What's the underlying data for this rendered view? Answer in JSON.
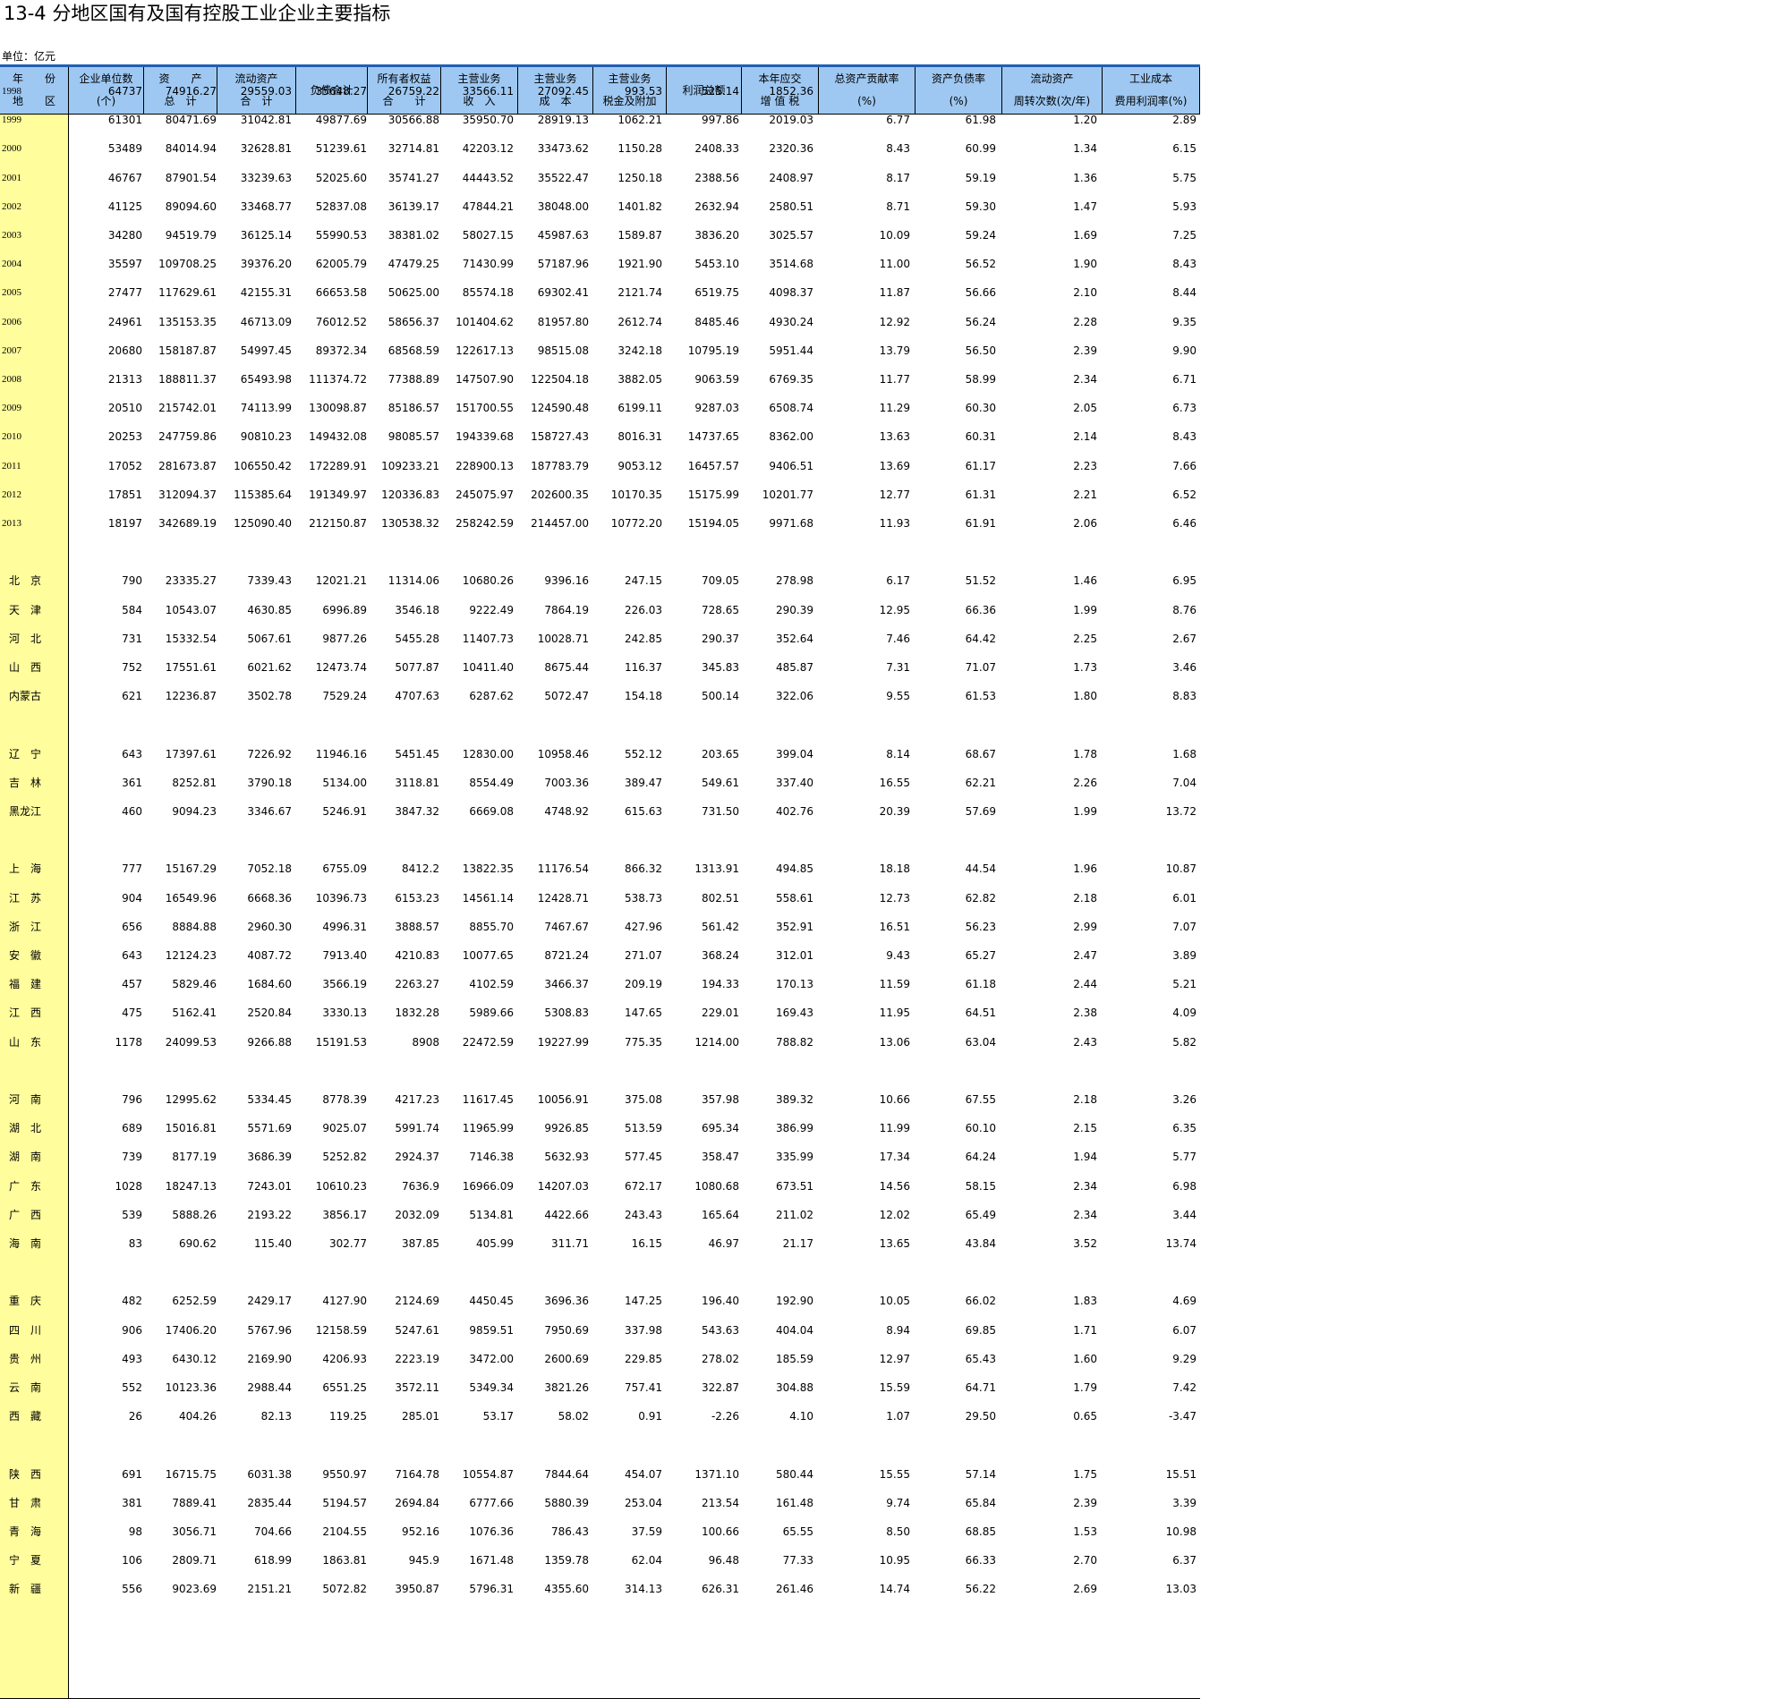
{
  "title": "13-4   分地区国有及国有控股工业企业主要指标",
  "unit": "单位：亿元",
  "columns": [
    {
      "l1": "年　　份",
      "l2": "地　　区"
    },
    {
      "l1": "企业单位数",
      "l2": "(个)"
    },
    {
      "l1": "资　　产",
      "l2": "总　计"
    },
    {
      "l1": "流动资产",
      "l2": "合　计"
    },
    {
      "l1": "负债合计",
      "l2": ""
    },
    {
      "l1": "所有者权益",
      "l2": "合　　计"
    },
    {
      "l1": "主营业务",
      "l2": "收　入"
    },
    {
      "l1": "主营业务",
      "l2": "成　本"
    },
    {
      "l1": "主营业务",
      "l2": "税金及附加"
    },
    {
      "l1": "利润总额",
      "l2": ""
    },
    {
      "l1": "本年应交",
      "l2": "增 值 税"
    },
    {
      "l1": "总资产贡献率",
      "l2": "(%)"
    },
    {
      "l1": "资产负债率",
      "l2": "(%)"
    },
    {
      "l1": "流动资产",
      "l2": "周转次数(次/年)"
    },
    {
      "l1": "工业成本",
      "l2": "费用利润率(%)"
    }
  ],
  "year_rows": [
    [
      "1998",
      "64737",
      "74916.27",
      "29559.03",
      "35648.27",
      "26759.22",
      "33566.11",
      "27092.45",
      "993.53",
      "525.14",
      "1852.36",
      "",
      "",
      "",
      ""
    ],
    [
      "1999",
      "61301",
      "80471.69",
      "31042.81",
      "49877.69",
      "30566.88",
      "35950.70",
      "28919.13",
      "1062.21",
      "997.86",
      "2019.03",
      "6.77",
      "61.98",
      "1.20",
      "2.89"
    ],
    [
      "2000",
      "53489",
      "84014.94",
      "32628.81",
      "51239.61",
      "32714.81",
      "42203.12",
      "33473.62",
      "1150.28",
      "2408.33",
      "2320.36",
      "8.43",
      "60.99",
      "1.34",
      "6.15"
    ],
    [
      "2001",
      "46767",
      "87901.54",
      "33239.63",
      "52025.60",
      "35741.27",
      "44443.52",
      "35522.47",
      "1250.18",
      "2388.56",
      "2408.97",
      "8.17",
      "59.19",
      "1.36",
      "5.75"
    ],
    [
      "2002",
      "41125",
      "89094.60",
      "33468.77",
      "52837.08",
      "36139.17",
      "47844.21",
      "38048.00",
      "1401.82",
      "2632.94",
      "2580.51",
      "8.71",
      "59.30",
      "1.47",
      "5.93"
    ],
    [
      "2003",
      "34280",
      "94519.79",
      "36125.14",
      "55990.53",
      "38381.02",
      "58027.15",
      "45987.63",
      "1589.87",
      "3836.20",
      "3025.57",
      "10.09",
      "59.24",
      "1.69",
      "7.25"
    ],
    [
      "2004",
      "35597",
      "109708.25",
      "39376.20",
      "62005.79",
      "47479.25",
      "71430.99",
      "57187.96",
      "1921.90",
      "5453.10",
      "3514.68",
      "11.00",
      "56.52",
      "1.90",
      "8.43"
    ],
    [
      "2005",
      "27477",
      "117629.61",
      "42155.31",
      "66653.58",
      "50625.00",
      "85574.18",
      "69302.41",
      "2121.74",
      "6519.75",
      "4098.37",
      "11.87",
      "56.66",
      "2.10",
      "8.44"
    ],
    [
      "2006",
      "24961",
      "135153.35",
      "46713.09",
      "76012.52",
      "58656.37",
      "101404.62",
      "81957.80",
      "2612.74",
      "8485.46",
      "4930.24",
      "12.92",
      "56.24",
      "2.28",
      "9.35"
    ],
    [
      "2007",
      "20680",
      "158187.87",
      "54997.45",
      "89372.34",
      "68568.59",
      "122617.13",
      "98515.08",
      "3242.18",
      "10795.19",
      "5951.44",
      "13.79",
      "56.50",
      "2.39",
      "9.90"
    ],
    [
      "2008",
      "21313",
      "188811.37",
      "65493.98",
      "111374.72",
      "77388.89",
      "147507.90",
      "122504.18",
      "3882.05",
      "9063.59",
      "6769.35",
      "11.77",
      "58.99",
      "2.34",
      "6.71"
    ],
    [
      "2009",
      "20510",
      "215742.01",
      "74113.99",
      "130098.87",
      "85186.57",
      "151700.55",
      "124590.48",
      "6199.11",
      "9287.03",
      "6508.74",
      "11.29",
      "60.30",
      "2.05",
      "6.73"
    ],
    [
      "2010",
      "20253",
      "247759.86",
      "90810.23",
      "149432.08",
      "98085.57",
      "194339.68",
      "158727.43",
      "8016.31",
      "14737.65",
      "8362.00",
      "13.63",
      "60.31",
      "2.14",
      "8.43"
    ],
    [
      "2011",
      "17052",
      "281673.87",
      "106550.42",
      "172289.91",
      "109233.21",
      "228900.13",
      "187783.79",
      "9053.12",
      "16457.57",
      "9406.51",
      "13.69",
      "61.17",
      "2.23",
      "7.66"
    ],
    [
      "2012",
      "17851",
      "312094.37",
      "115385.64",
      "191349.97",
      "120336.83",
      "245075.97",
      "202600.35",
      "10170.35",
      "15175.99",
      "10201.77",
      "12.77",
      "61.31",
      "2.21",
      "6.52"
    ],
    [
      "2013",
      "18197",
      "342689.19",
      "125090.40",
      "212150.87",
      "130538.32",
      "258242.59",
      "214457.00",
      "10772.20",
      "15194.05",
      "9971.68",
      "11.93",
      "61.91",
      "2.06",
      "6.46"
    ]
  ],
  "region_groups": [
    [
      [
        "北　京",
        "790",
        "23335.27",
        "7339.43",
        "12021.21",
        "11314.06",
        "10680.26",
        "9396.16",
        "247.15",
        "709.05",
        "278.98",
        "6.17",
        "51.52",
        "1.46",
        "6.95"
      ],
      [
        "天　津",
        "584",
        "10543.07",
        "4630.85",
        "6996.89",
        "3546.18",
        "9222.49",
        "7864.19",
        "226.03",
        "728.65",
        "290.39",
        "12.95",
        "66.36",
        "1.99",
        "8.76"
      ],
      [
        "河　北",
        "731",
        "15332.54",
        "5067.61",
        "9877.26",
        "5455.28",
        "11407.73",
        "10028.71",
        "242.85",
        "290.37",
        "352.64",
        "7.46",
        "64.42",
        "2.25",
        "2.67"
      ],
      [
        "山　西",
        "752",
        "17551.61",
        "6021.62",
        "12473.74",
        "5077.87",
        "10411.40",
        "8675.44",
        "116.37",
        "345.83",
        "485.87",
        "7.31",
        "71.07",
        "1.73",
        "3.46"
      ],
      [
        "内蒙古",
        "621",
        "12236.87",
        "3502.78",
        "7529.24",
        "4707.63",
        "6287.62",
        "5072.47",
        "154.18",
        "500.14",
        "322.06",
        "9.55",
        "61.53",
        "1.80",
        "8.83"
      ]
    ],
    [
      [
        "辽　宁",
        "643",
        "17397.61",
        "7226.92",
        "11946.16",
        "5451.45",
        "12830.00",
        "10958.46",
        "552.12",
        "203.65",
        "399.04",
        "8.14",
        "68.67",
        "1.78",
        "1.68"
      ],
      [
        "吉　林",
        "361",
        "8252.81",
        "3790.18",
        "5134.00",
        "3118.81",
        "8554.49",
        "7003.36",
        "389.47",
        "549.61",
        "337.40",
        "16.55",
        "62.21",
        "2.26",
        "7.04"
      ],
      [
        "黑龙江",
        "460",
        "9094.23",
        "3346.67",
        "5246.91",
        "3847.32",
        "6669.08",
        "4748.92",
        "615.63",
        "731.50",
        "402.76",
        "20.39",
        "57.69",
        "1.99",
        "13.72"
      ]
    ],
    [
      [
        "上　海",
        "777",
        "15167.29",
        "7052.18",
        "6755.09",
        "8412.2",
        "13822.35",
        "11176.54",
        "866.32",
        "1313.91",
        "494.85",
        "18.18",
        "44.54",
        "1.96",
        "10.87"
      ],
      [
        "江　苏",
        "904",
        "16549.96",
        "6668.36",
        "10396.73",
        "6153.23",
        "14561.14",
        "12428.71",
        "538.73",
        "802.51",
        "558.61",
        "12.73",
        "62.82",
        "2.18",
        "6.01"
      ],
      [
        "浙　江",
        "656",
        "8884.88",
        "2960.30",
        "4996.31",
        "3888.57",
        "8855.70",
        "7467.67",
        "427.96",
        "561.42",
        "352.91",
        "16.51",
        "56.23",
        "2.99",
        "7.07"
      ],
      [
        "安　徽",
        "643",
        "12124.23",
        "4087.72",
        "7913.40",
        "4210.83",
        "10077.65",
        "8721.24",
        "271.07",
        "368.24",
        "312.01",
        "9.43",
        "65.27",
        "2.47",
        "3.89"
      ],
      [
        "福　建",
        "457",
        "5829.46",
        "1684.60",
        "3566.19",
        "2263.27",
        "4102.59",
        "3466.37",
        "209.19",
        "194.33",
        "170.13",
        "11.59",
        "61.18",
        "2.44",
        "5.21"
      ],
      [
        "江　西",
        "475",
        "5162.41",
        "2520.84",
        "3330.13",
        "1832.28",
        "5989.66",
        "5308.83",
        "147.65",
        "229.01",
        "169.43",
        "11.95",
        "64.51",
        "2.38",
        "4.09"
      ],
      [
        "山　东",
        "1178",
        "24099.53",
        "9266.88",
        "15191.53",
        "8908",
        "22472.59",
        "19227.99",
        "775.35",
        "1214.00",
        "788.82",
        "13.06",
        "63.04",
        "2.43",
        "5.82"
      ]
    ],
    [
      [
        "河　南",
        "796",
        "12995.62",
        "5334.45",
        "8778.39",
        "4217.23",
        "11617.45",
        "10056.91",
        "375.08",
        "357.98",
        "389.32",
        "10.66",
        "67.55",
        "2.18",
        "3.26"
      ],
      [
        "湖　北",
        "689",
        "15016.81",
        "5571.69",
        "9025.07",
        "5991.74",
        "11965.99",
        "9926.85",
        "513.59",
        "695.34",
        "386.99",
        "11.99",
        "60.10",
        "2.15",
        "6.35"
      ],
      [
        "湖　南",
        "739",
        "8177.19",
        "3686.39",
        "5252.82",
        "2924.37",
        "7146.38",
        "5632.93",
        "577.45",
        "358.47",
        "335.99",
        "17.34",
        "64.24",
        "1.94",
        "5.77"
      ],
      [
        "广　东",
        "1028",
        "18247.13",
        "7243.01",
        "10610.23",
        "7636.9",
        "16966.09",
        "14207.03",
        "672.17",
        "1080.68",
        "673.51",
        "14.56",
        "58.15",
        "2.34",
        "6.98"
      ],
      [
        "广　西",
        "539",
        "5888.26",
        "2193.22",
        "3856.17",
        "2032.09",
        "5134.81",
        "4422.66",
        "243.43",
        "165.64",
        "211.02",
        "12.02",
        "65.49",
        "2.34",
        "3.44"
      ],
      [
        "海　南",
        "83",
        "690.62",
        "115.40",
        "302.77",
        "387.85",
        "405.99",
        "311.71",
        "16.15",
        "46.97",
        "21.17",
        "13.65",
        "43.84",
        "3.52",
        "13.74"
      ]
    ],
    [
      [
        "重　庆",
        "482",
        "6252.59",
        "2429.17",
        "4127.90",
        "2124.69",
        "4450.45",
        "3696.36",
        "147.25",
        "196.40",
        "192.90",
        "10.05",
        "66.02",
        "1.83",
        "4.69"
      ],
      [
        "四　川",
        "906",
        "17406.20",
        "5767.96",
        "12158.59",
        "5247.61",
        "9859.51",
        "7950.69",
        "337.98",
        "543.63",
        "404.04",
        "8.94",
        "69.85",
        "1.71",
        "6.07"
      ],
      [
        "贵　州",
        "493",
        "6430.12",
        "2169.90",
        "4206.93",
        "2223.19",
        "3472.00",
        "2600.69",
        "229.85",
        "278.02",
        "185.59",
        "12.97",
        "65.43",
        "1.60",
        "9.29"
      ],
      [
        "云　南",
        "552",
        "10123.36",
        "2988.44",
        "6551.25",
        "3572.11",
        "5349.34",
        "3821.26",
        "757.41",
        "322.87",
        "304.88",
        "15.59",
        "64.71",
        "1.79",
        "7.42"
      ],
      [
        "西　藏",
        "26",
        "404.26",
        "82.13",
        "119.25",
        "285.01",
        "53.17",
        "58.02",
        "0.91",
        "-2.26",
        "4.10",
        "1.07",
        "29.50",
        "0.65",
        "-3.47"
      ]
    ],
    [
      [
        "陕　西",
        "691",
        "16715.75",
        "6031.38",
        "9550.97",
        "7164.78",
        "10554.87",
        "7844.64",
        "454.07",
        "1371.10",
        "580.44",
        "15.55",
        "57.14",
        "1.75",
        "15.51"
      ],
      [
        "甘　肃",
        "381",
        "7889.41",
        "2835.44",
        "5194.57",
        "2694.84",
        "6777.66",
        "5880.39",
        "253.04",
        "213.54",
        "161.48",
        "9.74",
        "65.84",
        "2.39",
        "3.39"
      ],
      [
        "青　海",
        "98",
        "3056.71",
        "704.66",
        "2104.55",
        "952.16",
        "1076.36",
        "786.43",
        "37.59",
        "100.66",
        "65.55",
        "8.50",
        "68.85",
        "1.53",
        "10.98"
      ],
      [
        "宁　夏",
        "106",
        "2809.71",
        "618.99",
        "1863.81",
        "945.9",
        "1671.48",
        "1359.78",
        "62.04",
        "96.48",
        "77.33",
        "10.95",
        "66.33",
        "2.70",
        "6.37"
      ],
      [
        "新　疆",
        "556",
        "9023.69",
        "2151.21",
        "5072.82",
        "3950.87",
        "5796.31",
        "4355.60",
        "314.13",
        "626.31",
        "261.46",
        "14.74",
        "56.22",
        "2.69",
        "13.03"
      ]
    ]
  ],
  "colors": {
    "header_bg": "#9ec8f2",
    "header_line": "#1f5fb4",
    "label_column_bg": "#fffd9c"
  }
}
